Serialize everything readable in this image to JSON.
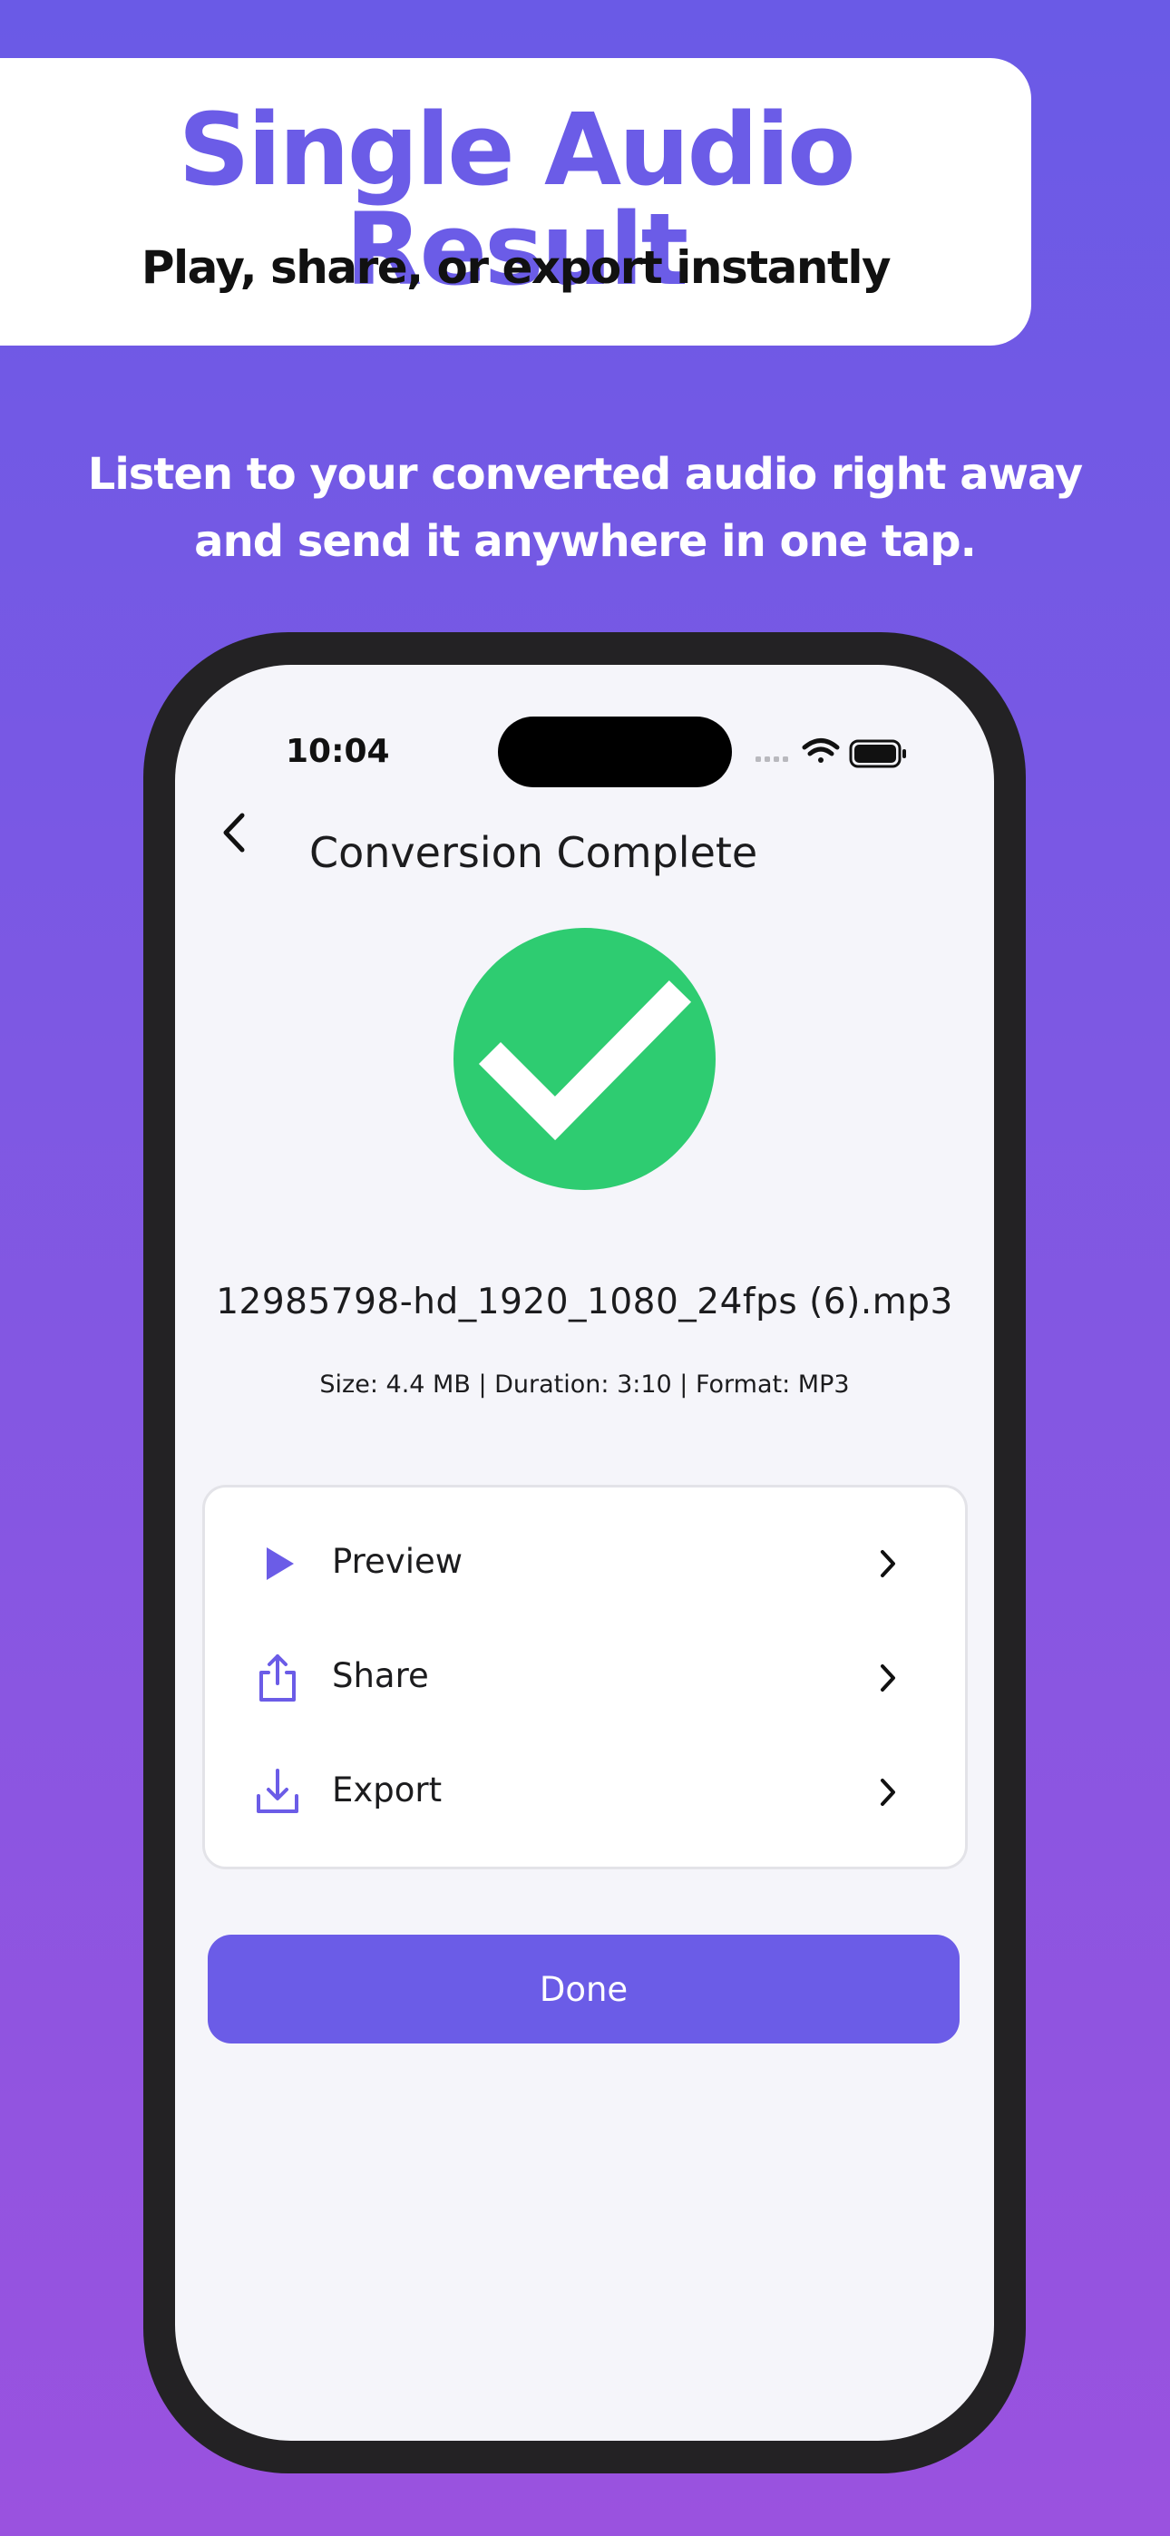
{
  "promo": {
    "title": "Single Audio Result",
    "subtitle": "Play, share, or export instantly",
    "description_line1": "Listen to your converted audio right away",
    "description_line2": "and send it anywhere in one tap."
  },
  "status_bar": {
    "time": "10:04",
    "icons": [
      "signal-icon",
      "wifi-icon",
      "battery-icon"
    ]
  },
  "nav": {
    "back_icon": "chevron-left-icon",
    "title": "Conversion Complete"
  },
  "result": {
    "status_icon": "checkmark-circle-icon",
    "file_name": "12985798-hd_1920_1080_24fps (6).mp3",
    "meta": "Size: 4.4 MB | Duration: 3:10 | Format: MP3"
  },
  "actions": [
    {
      "label": "Preview",
      "icon": "play-icon"
    },
    {
      "label": "Share",
      "icon": "share-icon"
    },
    {
      "label": "Export",
      "icon": "download-icon"
    }
  ],
  "done_label": "Done",
  "colors": {
    "accent": "#6b5ce7",
    "success": "#2ecc71",
    "background_top": "#6a5ae6",
    "background_bottom": "#9a52df"
  }
}
